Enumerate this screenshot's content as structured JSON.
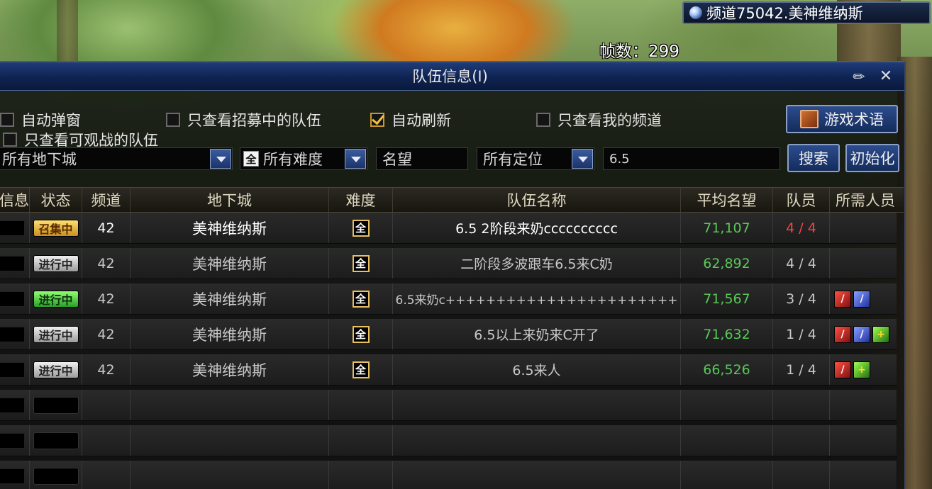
{
  "hud": {
    "channel": "频道75042.美神维纳斯",
    "fps_label": "帧数：299"
  },
  "panel": {
    "title": "队伍信息(I)",
    "options": {
      "auto_popup": "自动弹窗",
      "only_recruiting": "只查看招募中的队伍",
      "auto_refresh": "自动刷新",
      "only_my_channel": "只查看我的频道",
      "only_spectate": "只查看可观战的队伍"
    },
    "glossary_button": "游戏术语",
    "search_button": "搜索",
    "reset_button": "初始化",
    "filters": {
      "dungeon": "所有地下城",
      "difficulty_badge": "全",
      "difficulty": "所有难度",
      "reputation": "名望",
      "role": "所有定位",
      "keyword": "6.5"
    },
    "columns": [
      "信息",
      "状态",
      "频道",
      "地下城",
      "难度",
      "队伍名称",
      "平均名望",
      "队员",
      "所需人员"
    ],
    "rows": [
      {
        "status": "召集中",
        "channel": "42",
        "dungeon": "美神维纳斯",
        "difficulty": "全",
        "name": "6.5 2阶段来奶cccccccccc",
        "reputation": "71,107",
        "members": "4 / 4"
      },
      {
        "status": "进行中",
        "channel": "42",
        "dungeon": "美神维纳斯",
        "difficulty": "全",
        "name": "二阶段多波跟车6.5来C奶",
        "reputation": "62,892",
        "members": "4 / 4"
      },
      {
        "status": "进行中",
        "channel": "42",
        "dungeon": "美神维纳斯",
        "difficulty": "全",
        "name": "6.5来奶c+++++++++++++++++++++++",
        "reputation": "71,567",
        "members": "3 / 4"
      },
      {
        "status": "进行中",
        "channel": "42",
        "dungeon": "美神维纳斯",
        "difficulty": "全",
        "name": "6.5以上来奶来C开了",
        "reputation": "71,632",
        "members": "1 / 4"
      },
      {
        "status": "进行中",
        "channel": "42",
        "dungeon": "美神维纳斯",
        "difficulty": "全",
        "name": "6.5来人",
        "reputation": "66,526",
        "members": "1 / 4"
      }
    ],
    "role_icons": {
      "dps": "sword-red-icon",
      "dps_blue": "sword-blue-icon",
      "healer": "cross-green-icon"
    }
  }
}
